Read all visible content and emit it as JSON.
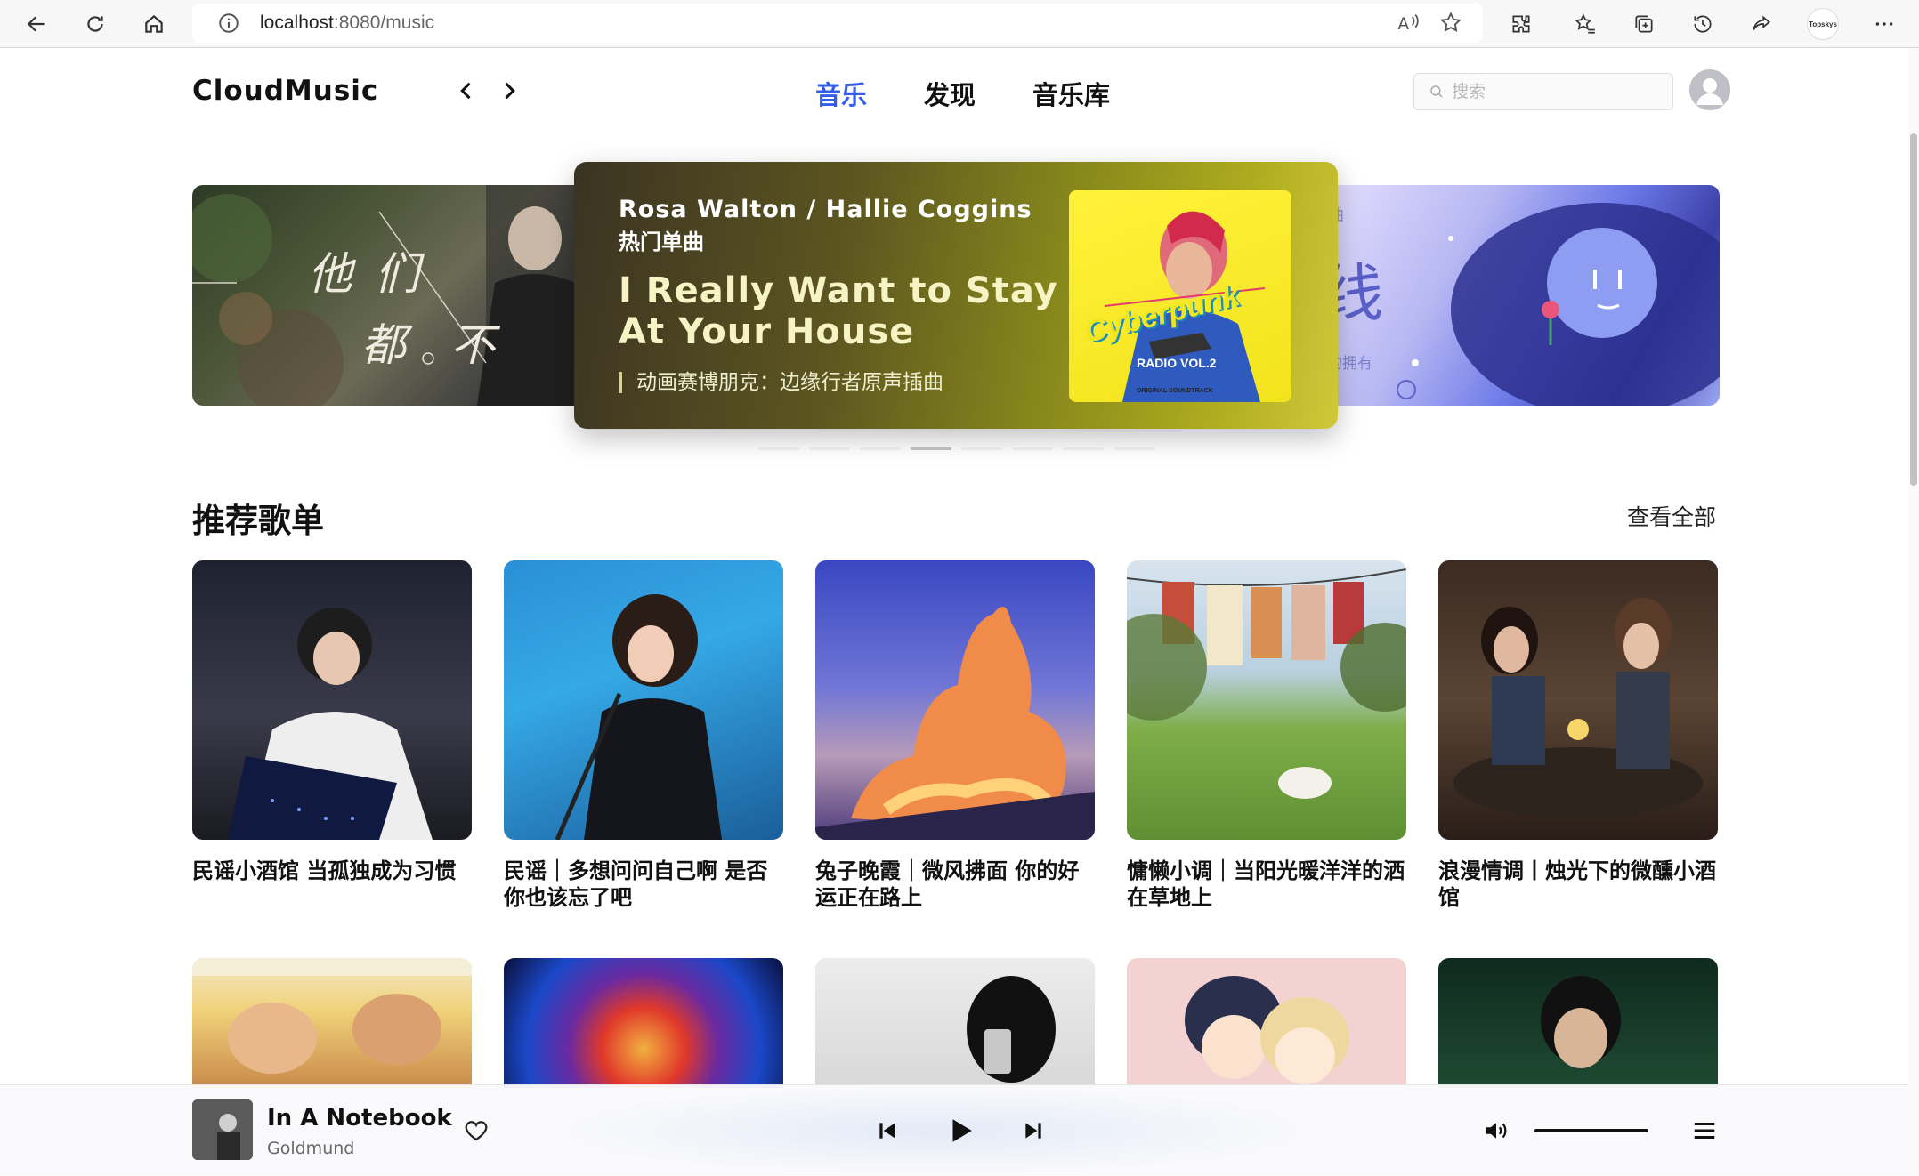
{
  "browser": {
    "url_host": "localhost",
    "url_path": ":8080/music",
    "profile_label": "Topskys"
  },
  "app": {
    "logo": "CloudMusic",
    "nav": [
      {
        "label": "音乐",
        "active": true
      },
      {
        "label": "发现",
        "active": false
      },
      {
        "label": "音乐库",
        "active": false
      }
    ],
    "search_placeholder": "搜索"
  },
  "banner": {
    "center": {
      "artist": "Rosa Walton / Hallie Coggins",
      "tag": "热门单曲",
      "title": "I Really Want to Stay At Your House",
      "subtitle": "动画赛博朋克：边缘行者原声插曲",
      "cover_text": "Cyberpunk",
      "cover_small": "RADIO VOL.2",
      "cover_tiny": "ORIGINAL SOUNDTRACK"
    },
    "left_text": [
      "他",
      "们",
      "都",
      "不"
    ],
    "right_text": [
      "单曲",
      "线",
      "存的拥有"
    ],
    "dots": 8,
    "active_dot": 3
  },
  "section": {
    "title": "推荐歌单",
    "see_all": "查看全部"
  },
  "playlists": [
    {
      "name": "民谣小酒馆 当孤独成为习惯"
    },
    {
      "name": "民谣｜多想问问自己啊 是否你也该忘了吧"
    },
    {
      "name": "兔子晚霞｜微风拂面 你的好运正在路上"
    },
    {
      "name": "慵懒小调｜当阳光暖洋洋的洒在草地上"
    },
    {
      "name": "浪漫情调丨烛光下的微醺小酒馆"
    }
  ],
  "player": {
    "title": "In A Notebook",
    "artist": "Goldmund",
    "volume": 1.0
  },
  "colors": {
    "accent": "#335eea"
  }
}
